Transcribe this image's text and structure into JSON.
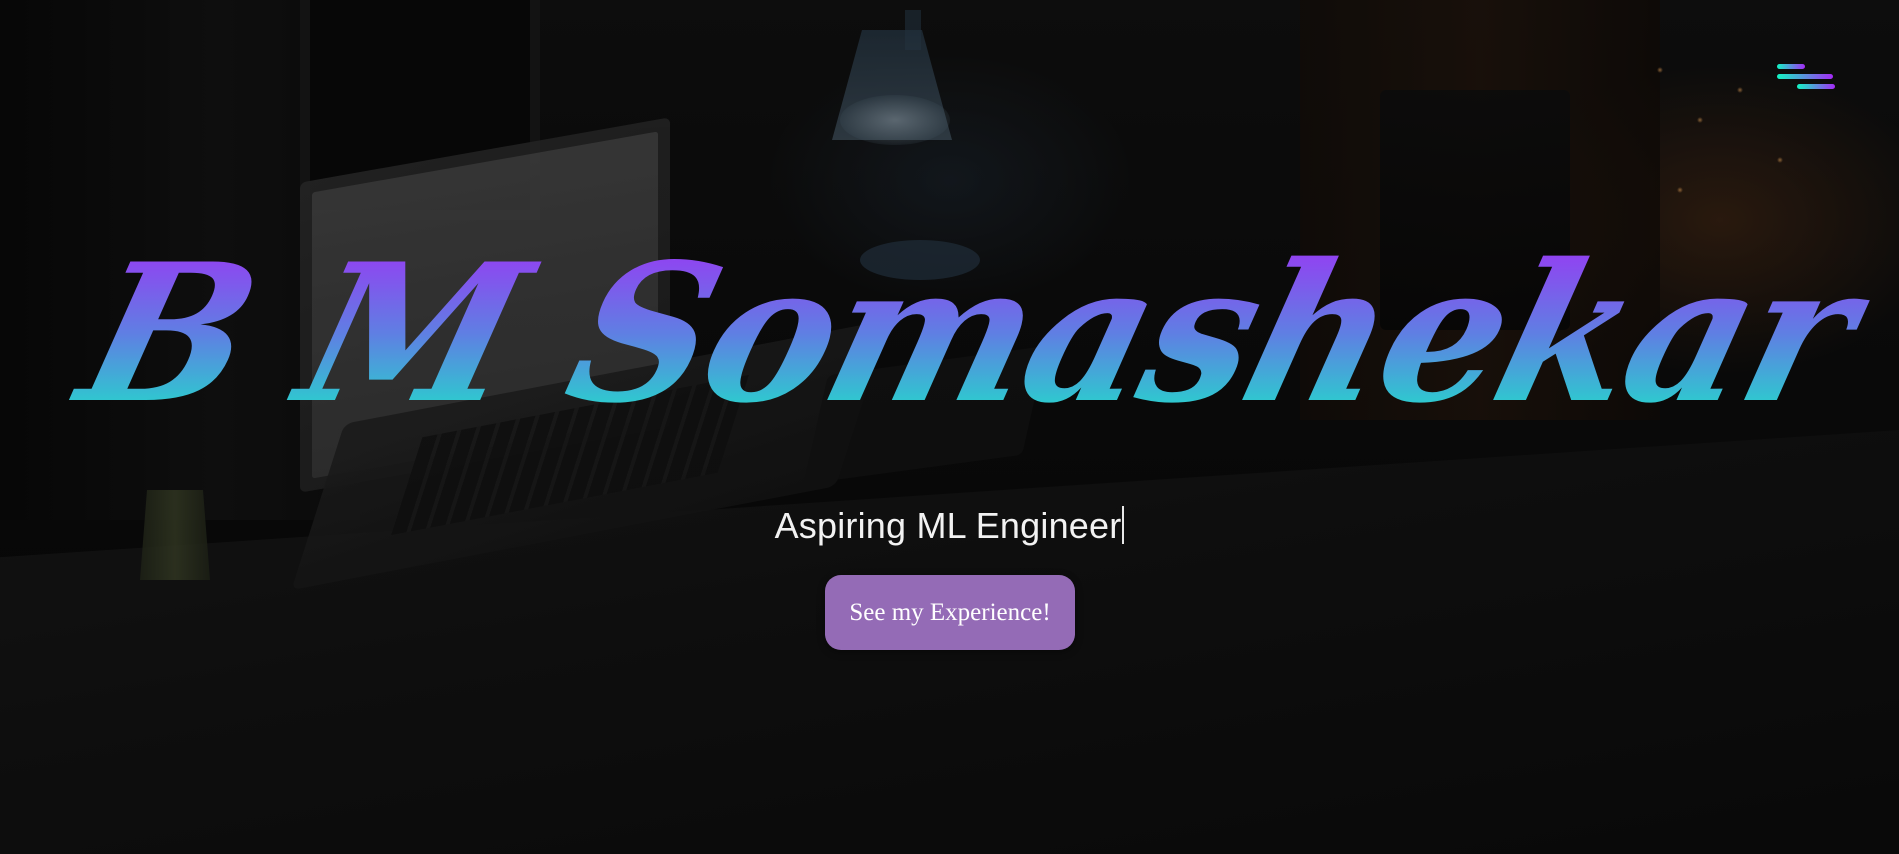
{
  "header": {
    "menu_icon": "hamburger-menu-icon"
  },
  "hero": {
    "name": "B M Somashekar",
    "subtitle": "Aspiring ML Engineer",
    "cta_label": "See my Experience!"
  },
  "colors": {
    "name_gradient_top": "#a52af7",
    "name_gradient_bottom": "#11f5c3",
    "button_background": "#946bb6",
    "subtitle_text": "#f2f2f2",
    "menu_gradient_start": "#11f5c3",
    "menu_gradient_end": "#a52af7"
  }
}
